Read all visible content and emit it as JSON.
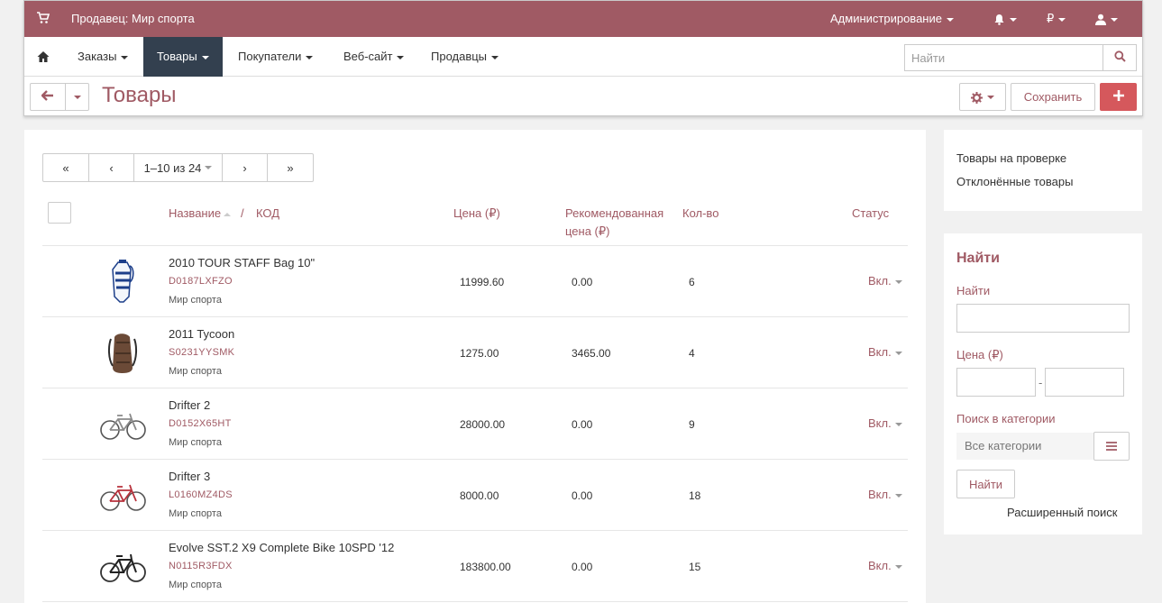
{
  "colors": {
    "accent": "#a05a64",
    "topbar": "#a05a64",
    "nav_active": "#33404f",
    "add_button": "#d5585c"
  },
  "topbar": {
    "vendor_label": "Продавец: Мир спорта",
    "admin_label": "Администрирование",
    "currency_label": "₽",
    "icons": [
      "shopping-cart-icon",
      "bell-icon",
      "user-icon"
    ]
  },
  "nav": {
    "items": [
      {
        "label": "Заказы"
      },
      {
        "label": "Товары",
        "active": true
      },
      {
        "label": "Покупатели"
      },
      {
        "label": "Веб-сайт"
      },
      {
        "label": "Продавцы"
      }
    ],
    "search_placeholder": "Найти"
  },
  "title_bar": {
    "title": "Товары",
    "save_label": "Сохранить"
  },
  "pager": {
    "first": "«",
    "prev": "‹",
    "range": "1–10 из 24",
    "next": "›",
    "last": "»"
  },
  "table": {
    "headers": {
      "name": "Название",
      "separator": "/",
      "code": "КОД",
      "price": "Цена (₽)",
      "list_price_line1": "Рекомендованная",
      "list_price_line2": "цена (₽)",
      "qty": "Кол-во",
      "status": "Статус"
    },
    "rows": [
      {
        "name": "2010 TOUR STAFF Bag 10\"",
        "code": "D0187LXFZO",
        "seller": "Мир спорта",
        "price": "11999.60",
        "list_price": "0.00",
        "qty": "6",
        "status": "Вкл.",
        "thumb": "golf-bag"
      },
      {
        "name": "2011 Tycoon",
        "code": "S0231YYSMK",
        "seller": "Мир спорта",
        "price": "1275.00",
        "list_price": "3465.00",
        "qty": "4",
        "status": "Вкл.",
        "thumb": "backpack"
      },
      {
        "name": "Drifter 2",
        "code": "D0152X65HT",
        "seller": "Мир спорта",
        "price": "28000.00",
        "list_price": "0.00",
        "qty": "9",
        "status": "Вкл.",
        "thumb": "bike-gray"
      },
      {
        "name": "Drifter 3",
        "code": "L0160MZ4DS",
        "seller": "Мир спорта",
        "price": "8000.00",
        "list_price": "0.00",
        "qty": "18",
        "status": "Вкл.",
        "thumb": "bike-red"
      },
      {
        "name": "Evolve SST.2 X9 Complete Bike 10SPD '12",
        "code": "N0115R3FDX",
        "seller": "Мир спорта",
        "price": "183800.00",
        "list_price": "0.00",
        "qty": "15",
        "status": "Вкл.",
        "thumb": "bike-black"
      }
    ]
  },
  "sidebar": {
    "links": [
      "Товары на проверке",
      "Отклонённые товары"
    ],
    "search": {
      "title": "Найти",
      "find_label": "Найти",
      "price_label": "Цена (₽)",
      "price_dash": "-",
      "category_label": "Поиск в категории",
      "category_value": "Все категории",
      "find_button": "Найти",
      "advanced_link": "Расширенный поиск"
    }
  }
}
